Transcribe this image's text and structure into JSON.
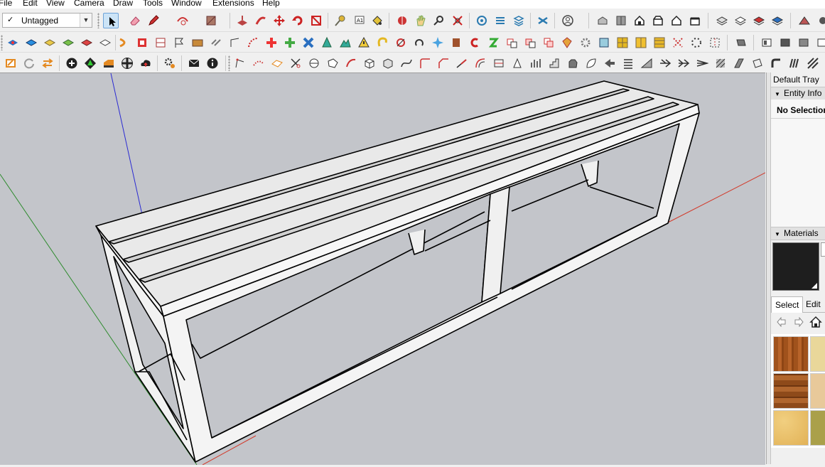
{
  "menu": [
    "File",
    "Edit",
    "View",
    "Camera",
    "Draw",
    "Tools",
    "Window",
    "Extensions",
    "Help"
  ],
  "tag_selector": {
    "check": "✓",
    "value": "Untagged"
  },
  "tray": {
    "title": "Default Tray",
    "entity_info": {
      "header": "Entity Info",
      "body": "No Selection"
    },
    "materials": {
      "header": "Materials",
      "current_color": "#1e1e1e",
      "tabs": {
        "select": "Select",
        "edit": "Edit"
      },
      "nav": [
        "back-arrow-icon",
        "forward-arrow-icon",
        "home-icon"
      ],
      "swatches": [
        "wood-floor-cherry",
        "wood-light-pale",
        "wood-floor-parquet",
        "wood-light-maple",
        "cork-yellow",
        "olive-green"
      ]
    }
  },
  "colors": {
    "axis_red": "#d23a2a",
    "axis_green": "#2e8b2e",
    "axis_blue": "#2a2ad2",
    "viewport_bg": "#c3c5ca",
    "bench_face": "#e8e8e8"
  }
}
